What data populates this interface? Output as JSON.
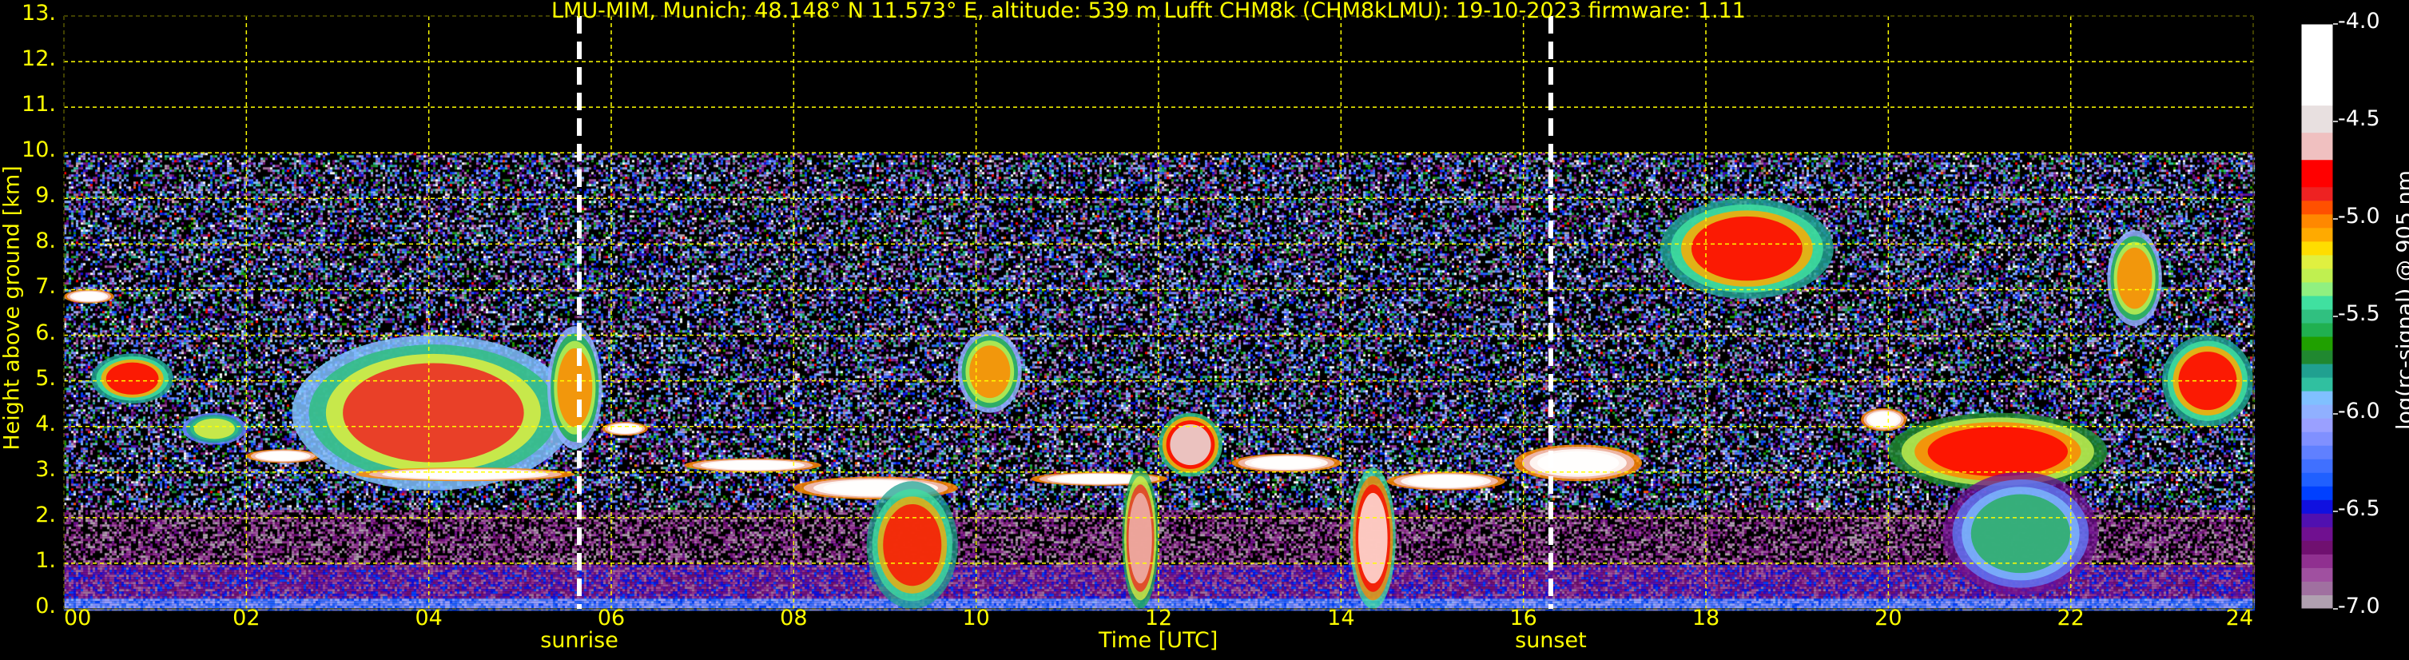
{
  "chart_data": {
    "type": "heatmap",
    "title": "LMU-MIM, Munich; 48.148° N 11.573° E, altitude: 539 m    Lufft CHM8k (CHM8kLMU): 19-10-2023    firmware: 1.11",
    "xlabel": "Time [UTC]",
    "ylabel": "Height above ground [km]",
    "xlim": [
      0,
      24
    ],
    "ylim": [
      0,
      13
    ],
    "data_top_km": 10,
    "x_ticks": [
      0,
      2,
      4,
      6,
      8,
      10,
      12,
      14,
      16,
      18,
      20,
      22,
      24
    ],
    "x_tick_labels": [
      "00",
      "02",
      "04",
      "06",
      "08",
      "10",
      "12",
      "14",
      "16",
      "18",
      "20",
      "22",
      "24"
    ],
    "y_ticks": [
      0,
      1,
      2,
      3,
      4,
      5,
      6,
      7,
      8,
      9,
      10,
      11,
      12,
      13
    ],
    "y_tick_labels": [
      "0.",
      "1.",
      "2.",
      "3.",
      "4.",
      "5.",
      "6.",
      "7.",
      "8.",
      "9.",
      "10.",
      "11.",
      "12.",
      "13."
    ],
    "grid": true,
    "grid_color": "#ffff00",
    "annotations": [
      {
        "label": "sunrise",
        "time": 5.65
      },
      {
        "label": "sunset",
        "time": 16.3
      }
    ],
    "colorbar": {
      "label": "log(rc-signal) @ 905 nm",
      "range": [
        -7.0,
        -4.0
      ],
      "tick_values": [
        -4.0,
        -4.5,
        -5.0,
        -5.5,
        -6.0,
        -6.5,
        -7.0
      ],
      "tick_labels": [
        "-4.0",
        "-4.5",
        "-5.0",
        "-5.5",
        "-6.0",
        "-6.5",
        "-7.0"
      ],
      "colors": [
        "#ffffff",
        "#ffffff",
        "#ffffff",
        "#ffffff",
        "#ffffff",
        "#ffffff",
        "#e8e0e0",
        "#e8e0e0",
        "#f0c0c0",
        "#f0c0c0",
        "#ff0000",
        "#ff0000",
        "#ee2222",
        "#ff5000",
        "#ff8800",
        "#ffaa00",
        "#ffdd00",
        "#e0f040",
        "#c0f050",
        "#90f080",
        "#40e0a0",
        "#30c080",
        "#20b050",
        "#20a000",
        "#208830",
        "#20a090",
        "#30c0a0",
        "#80c0ff",
        "#90b0ff",
        "#9aa0ff",
        "#8090ff",
        "#6080ff",
        "#4070ff",
        "#2060ff",
        "#0040ff",
        "#1010e0",
        "#5010b0",
        "#701090",
        "#701070",
        "#903090",
        "#a050a0",
        "#a070a0",
        "#b0a0b0"
      ]
    },
    "features": [
      {
        "kind": "cloud",
        "t0": 0.0,
        "t1": 0.55,
        "h0": 6.7,
        "h1": 7.0,
        "level": -4.0
      },
      {
        "kind": "cloud",
        "t0": 0.3,
        "t1": 1.2,
        "h0": 4.5,
        "h1": 5.6,
        "level": -4.8
      },
      {
        "kind": "cloud",
        "t0": 1.3,
        "t1": 2.0,
        "h0": 3.6,
        "h1": 4.3,
        "level": -5.2
      },
      {
        "kind": "cloud",
        "t0": 2.0,
        "t1": 2.8,
        "h0": 3.2,
        "h1": 3.5,
        "level": -4.0
      },
      {
        "kind": "cloud",
        "t0": 2.5,
        "t1": 5.6,
        "h0": 2.6,
        "h1": 6.0,
        "level": -4.9
      },
      {
        "kind": "cloud",
        "t0": 3.2,
        "t1": 5.6,
        "h0": 2.8,
        "h1": 3.1,
        "level": -4.0
      },
      {
        "kind": "cloud",
        "t0": 5.3,
        "t1": 5.9,
        "h0": 3.5,
        "h1": 6.2,
        "level": -5.0
      },
      {
        "kind": "cloud",
        "t0": 5.9,
        "t1": 6.4,
        "h0": 3.8,
        "h1": 4.1,
        "level": -4.0
      },
      {
        "kind": "cloud",
        "t0": 6.8,
        "t1": 8.3,
        "h0": 3.0,
        "h1": 3.3,
        "level": -4.0
      },
      {
        "kind": "cloud",
        "t0": 8.0,
        "t1": 9.8,
        "h0": 2.4,
        "h1": 2.9,
        "level": -4.0
      },
      {
        "kind": "precip",
        "t0": 8.8,
        "t1": 9.8,
        "h0": 0.0,
        "h1": 2.8,
        "level": -4.8
      },
      {
        "kind": "cloud",
        "t0": 9.8,
        "t1": 10.5,
        "h0": 4.3,
        "h1": 6.1,
        "level": -5.0
      },
      {
        "kind": "cloud",
        "t0": 10.6,
        "t1": 12.1,
        "h0": 2.7,
        "h1": 3.0,
        "level": -4.0
      },
      {
        "kind": "precip",
        "t0": 11.6,
        "t1": 12.0,
        "h0": 0.0,
        "h1": 3.1,
        "level": -4.6
      },
      {
        "kind": "cloud",
        "t0": 12.0,
        "t1": 12.7,
        "h0": 2.9,
        "h1": 4.3,
        "level": -4.5
      },
      {
        "kind": "cloud",
        "t0": 12.8,
        "t1": 14.0,
        "h0": 3.0,
        "h1": 3.4,
        "level": -4.0
      },
      {
        "kind": "precip",
        "t0": 14.1,
        "t1": 14.6,
        "h0": 0.0,
        "h1": 3.1,
        "level": -4.4
      },
      {
        "kind": "cloud",
        "t0": 14.5,
        "t1": 15.8,
        "h0": 2.6,
        "h1": 3.0,
        "level": -4.0
      },
      {
        "kind": "cloud",
        "t0": 15.9,
        "t1": 17.3,
        "h0": 2.8,
        "h1": 3.6,
        "level": -4.0
      },
      {
        "kind": "cloud",
        "t0": 17.5,
        "t1": 19.4,
        "h0": 6.8,
        "h1": 9.0,
        "level": -4.8
      },
      {
        "kind": "cloud",
        "t0": 19.7,
        "t1": 20.2,
        "h0": 3.9,
        "h1": 4.4,
        "level": -4.0
      },
      {
        "kind": "cloud",
        "t0": 20.0,
        "t1": 22.4,
        "h0": 2.6,
        "h1": 4.3,
        "level": -4.7
      },
      {
        "kind": "precip",
        "t0": 20.6,
        "t1": 22.3,
        "h0": 0.3,
        "h1": 3.0,
        "level": -5.6
      },
      {
        "kind": "cloud",
        "t0": 22.4,
        "t1": 23.0,
        "h0": 6.2,
        "h1": 8.3,
        "level": -5.0
      },
      {
        "kind": "cloud",
        "t0": 23.0,
        "t1": 24.0,
        "h0": 4.0,
        "h1": 6.0,
        "level": -4.8
      }
    ]
  }
}
